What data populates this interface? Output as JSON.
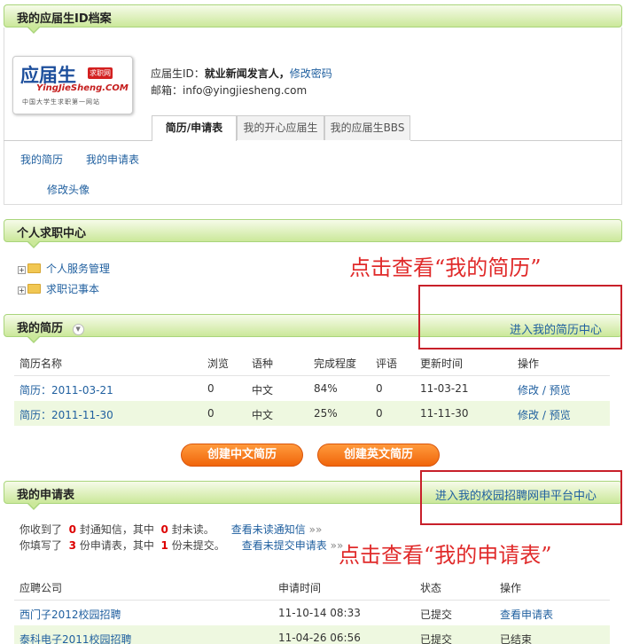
{
  "profile": {
    "title": "我的应届生ID档案",
    "logo": {
      "main": "应届生",
      "badge": "求职网",
      "domain": "YingJieSheng.COM",
      "slogan": "中国大学生求职第一网站"
    },
    "id_label": "应届生ID：",
    "id_value": "就业新闻发言人，",
    "change_password": "修改密码",
    "email_label": "邮箱：",
    "email_value": "info@yingjiesheng.com",
    "tabs": [
      "简历/申请表",
      "我的开心应届生",
      "我的应届生BBS"
    ],
    "links": [
      "我的简历",
      "我的申请表",
      "修改头像"
    ]
  },
  "job_center": {
    "title": "个人求职中心",
    "tree": [
      "个人服务管理",
      "求职记事本"
    ]
  },
  "annotations": {
    "resume": "点击查看“我的简历”",
    "application": "点击查看“我的申请表”"
  },
  "resume": {
    "title": "我的简历",
    "center_link": "进入我的简历中心",
    "headers": [
      "简历名称",
      "浏览",
      "语种",
      "完成程度",
      "评语",
      "更新时间",
      "操作"
    ],
    "rows": [
      {
        "name": "简历：2011-03-21",
        "views": "0",
        "lang": "中文",
        "complete": "84%",
        "comments": "0",
        "updated": "11-03-21",
        "edit": "修改",
        "preview": "/ 预览"
      },
      {
        "name": "简历：2011-11-30",
        "views": "0",
        "lang": "中文",
        "complete": "25%",
        "comments": "0",
        "updated": "11-11-30",
        "edit": "修改",
        "preview": "/ 预览"
      }
    ],
    "create_cn": "创建中文简历",
    "create_en": "创建英文简历"
  },
  "applications": {
    "title": "我的申请表",
    "center_link": "进入我的校园招聘网申平台中心",
    "notice": {
      "l1_a": "你收到了",
      "l1_n1": "0",
      "l1_b": "封通知信，其中",
      "l1_n2": "0",
      "l1_c": "封未读。",
      "l1_link": "查看未读通知信",
      "l1_arrow": "»»",
      "l2_a": "你填写了",
      "l2_n1": "3",
      "l2_b": "份申请表，其中",
      "l2_n2": "1",
      "l2_c": "份未提交。",
      "l2_link": "查看未提交申请表",
      "l2_arrow": "»»"
    },
    "headers": [
      "应聘公司",
      "申请时间",
      "状态",
      "操作"
    ],
    "rows": [
      {
        "company": "西门子2012校园招聘",
        "time": "11-10-14 08:33",
        "status": "已提交",
        "action": "查看申请表"
      },
      {
        "company": "泰科电子2011校园招聘",
        "time": "11-04-26 06:56",
        "status": "已提交",
        "action": "已结束"
      }
    ]
  }
}
